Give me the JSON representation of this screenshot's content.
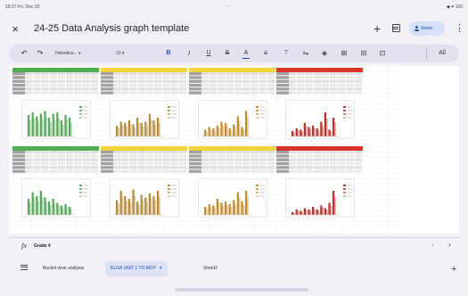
{
  "status": {
    "time_date": "18:27 Fri, Dec 20",
    "center_dots": "···",
    "right_indicators": "◆ ♥ 100"
  },
  "title_bar": {
    "close_glyph": "×",
    "doc_title": "24-25 Data Analysis graph template",
    "add_glyph": "+",
    "share_label": "Share",
    "more_glyph": "⋮"
  },
  "toolbar": {
    "undo_glyph": "↶",
    "redo_glyph": "↷",
    "font_label": "Helvetica...",
    "size_label": "10",
    "dropdown_caret": "▾",
    "bold": "B",
    "italic": "I",
    "underline": "U",
    "strikethrough": "S",
    "text_color": "A",
    "all_label": "All"
  },
  "formula_bar": {
    "fx_label": "fx",
    "value": "Grade 4",
    "left_glyph": "‹",
    "right_glyph": "›"
  },
  "tabs": {
    "items": [
      {
        "label": "Bucket wise analysis"
      },
      {
        "label": "ELGA UNIT 1 TO MOY",
        "active": true
      },
      {
        "label": "Sheet2"
      }
    ],
    "add_glyph": "+"
  },
  "colors": {
    "accent": "#1b4eb3",
    "header_green": "#4caf50",
    "header_yellow": "#f2d43a",
    "header_red": "#d9362b",
    "bar_green": "#58a85a",
    "bar_olive": "#b58a3a",
    "bar_brown": "#c58b2b",
    "bar_red": "#b8312a"
  },
  "blocks": [
    {
      "header": "green",
      "bars": "green",
      "heights": [
        0.8,
        0.9,
        0.75,
        0.85,
        0.95,
        0.7,
        0.85,
        0.9,
        0.6,
        0.8,
        0.7
      ]
    },
    {
      "header": "yellow",
      "bars": "olive",
      "heights": [
        0.4,
        0.55,
        0.5,
        0.6,
        0.45,
        0.7,
        0.5,
        0.55,
        0.85,
        0.6,
        0.7
      ]
    },
    {
      "header": "yellow",
      "bars": "brown",
      "heights": [
        0.25,
        0.35,
        0.3,
        0.4,
        0.55,
        0.5,
        0.3,
        0.45,
        0.75,
        0.35,
        0.95
      ]
    },
    {
      "header": "red",
      "bars": "red",
      "heights": [
        0.2,
        0.3,
        0.25,
        0.5,
        0.35,
        0.4,
        0.3,
        0.55,
        0.9,
        0.25,
        0.7
      ]
    },
    {
      "header": "green",
      "bars": "green",
      "heights": [
        0.6,
        0.85,
        0.7,
        0.9,
        0.65,
        0.5,
        0.6,
        0.45,
        0.35,
        0.4,
        0.3
      ]
    },
    {
      "header": "yellow",
      "bars": "olive",
      "heights": [
        0.55,
        0.9,
        0.7,
        0.6,
        0.95,
        0.5,
        0.75,
        0.65,
        0.8,
        0.7,
        0.9
      ]
    },
    {
      "header": "yellow",
      "bars": "brown",
      "heights": [
        0.3,
        0.4,
        0.35,
        0.6,
        0.45,
        0.5,
        0.4,
        0.55,
        0.85,
        0.5,
        0.9
      ]
    },
    {
      "header": "red",
      "bars": "red",
      "heights": [
        0.1,
        0.2,
        0.15,
        0.25,
        0.2,
        0.3,
        0.2,
        0.35,
        0.25,
        0.45,
        0.9
      ]
    }
  ]
}
